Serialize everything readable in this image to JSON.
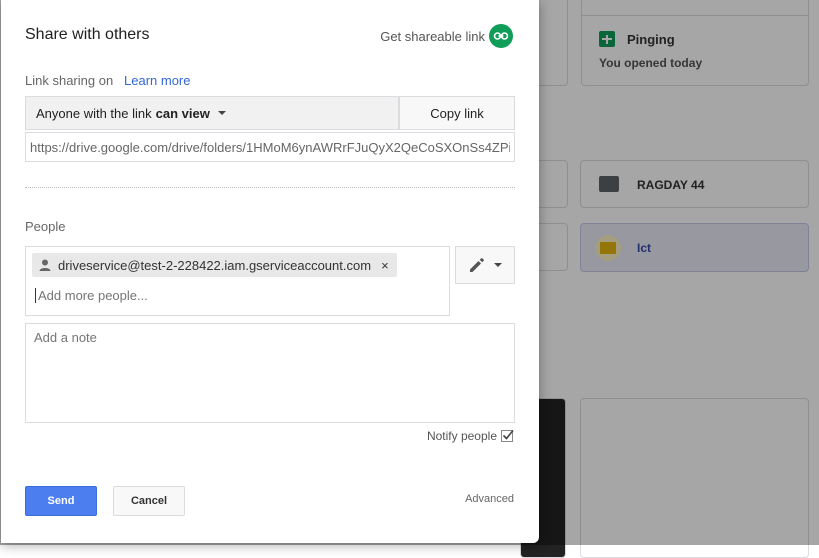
{
  "dialog": {
    "title": "Share with others",
    "get_shareable_link": "Get shareable link",
    "link_sharing_on": "Link sharing on",
    "learn_more": "Learn more",
    "anyone_prefix": "Anyone with the link",
    "anyone_permission": "can view",
    "copy_link": "Copy link",
    "link_url": "https://drive.google.com/drive/folders/1HMoM6ynAWRrFJuQyX2QeCoSXOnSs4ZPi",
    "people_label": "People",
    "chip_email": "driveservice@test-2-228422.iam.gserviceaccount.com",
    "chip_remove": "×",
    "add_people_placeholder": "Add more people...",
    "note_placeholder": "Add a note",
    "notify_label": "Notify people",
    "send": "Send",
    "cancel": "Cancel",
    "advanced": "Advanced"
  },
  "background": {
    "files": [
      {
        "name": "Pinging",
        "sub": "You opened today",
        "icon": "sheets-icon"
      },
      {
        "name": "RAGDAY 44",
        "icon": "shared-folder-icon"
      },
      {
        "name": "Ict",
        "icon": "shared-folder-icon",
        "selected": true
      }
    ]
  },
  "colors": {
    "accent": "#4d7ef0",
    "link": "#3367d6",
    "link_icon_bg": "#0f9d58",
    "selected_bg": "#e8eaf6"
  }
}
